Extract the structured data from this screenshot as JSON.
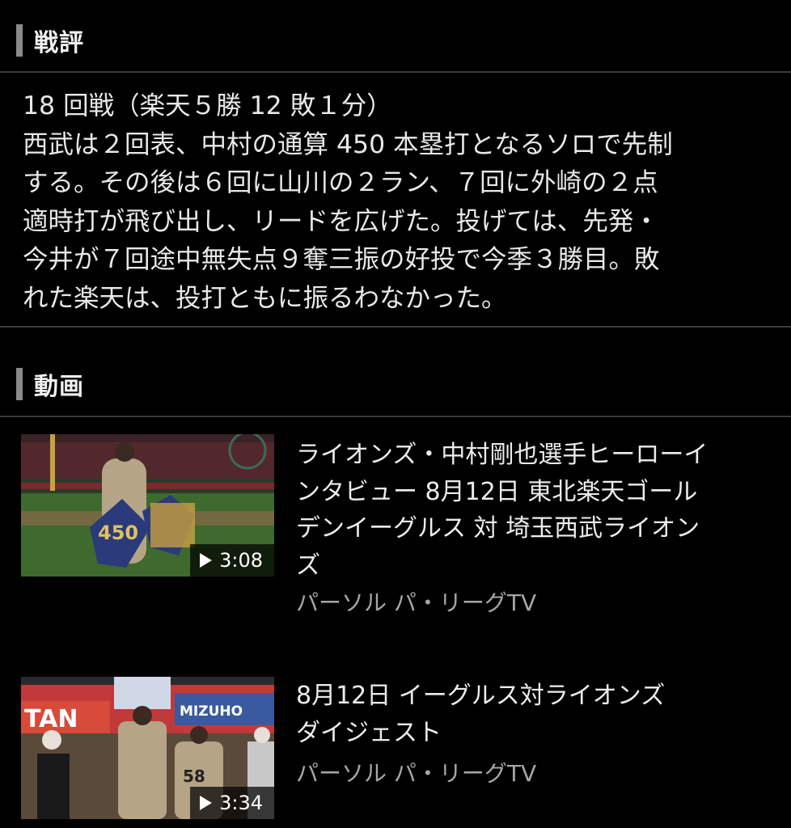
{
  "review": {
    "header": "戦評",
    "lines": [
      "18 回戦（楽天５勝 12 敗１分）",
      "西武は２回表、中村の通算 450 本塁打となるソロで先制",
      "する。その後は６回に山川の２ラン、７回に外崎の２点",
      "適時打が飛び出し、リードを広げた。投げては、先発・",
      "今井が７回途中無失点９奪三振の好投で今季３勝目。敗",
      "れた楽天は、投打ともに振るわなかった。"
    ]
  },
  "videos": {
    "header": "動画",
    "items": [
      {
        "title_lines": [
          "ライオンズ・中村剛也選手ヒーローイ",
          "ンタビュー 8月12日 東北楽天ゴール",
          "デンイーグルス 対 埼玉西武ライオン",
          "ズ"
        ],
        "source": "パーソル パ・リーグTV",
        "duration": "3:08"
      },
      {
        "title_lines": [
          "8月12日 イーグルス対ライオンズ",
          "ダイジェスト"
        ],
        "source": "パーソル パ・リーグTV",
        "duration": "3:34"
      }
    ]
  },
  "colors": {
    "background": "#000000",
    "header_bar": "#8a8a8a",
    "divider": "#3a3a3a",
    "text": "#e8e8e8",
    "source_text": "#a6a6a6"
  }
}
